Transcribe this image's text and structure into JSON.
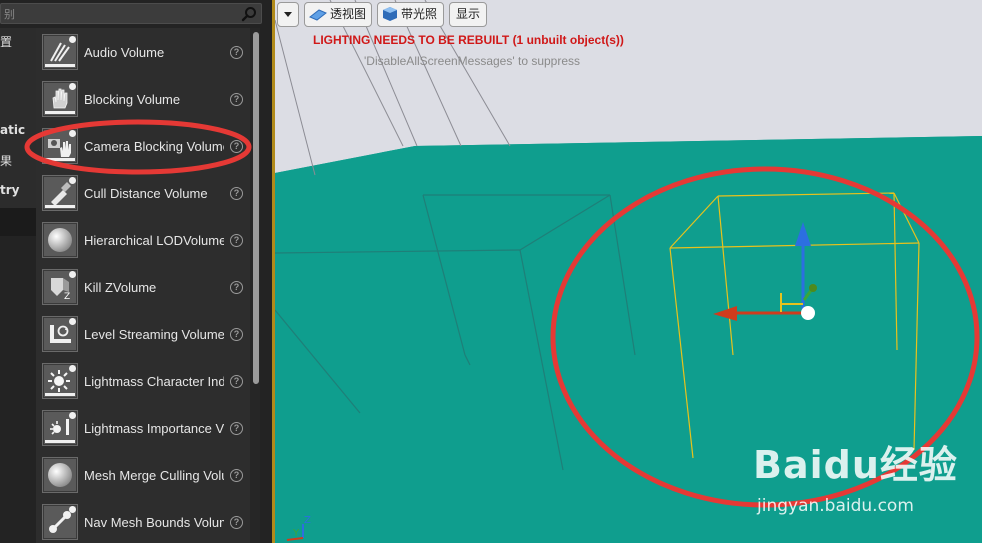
{
  "search": {
    "placeholder_fragment": "别"
  },
  "categories": [
    {
      "label": "置"
    },
    {
      "label": "atic"
    },
    {
      "label": "果"
    },
    {
      "label": "try"
    }
  ],
  "items": [
    {
      "label": "Audio Volume",
      "icon": "audio-volume-icon"
    },
    {
      "label": "Blocking Volume",
      "icon": "hand-icon"
    },
    {
      "label": "Camera Blocking Volume",
      "icon": "camera-hand-icon"
    },
    {
      "label": "Cull Distance Volume",
      "icon": "cull-distance-icon"
    },
    {
      "label": "Hierarchical LODVolume",
      "icon": "sphere-icon"
    },
    {
      "label": "Kill ZVolume",
      "icon": "kill-z-icon"
    },
    {
      "label": "Level Streaming Volume",
      "icon": "level-streaming-icon"
    },
    {
      "label": "Lightmass Character Indirect Detail Volume",
      "icon": "sun-icon"
    },
    {
      "label": "Lightmass Importance Volume",
      "icon": "lightbulb-icon"
    },
    {
      "label": "Mesh Merge Culling Volume",
      "icon": "sphere-icon"
    },
    {
      "label": "Nav Mesh Bounds Volume",
      "icon": "nav-mesh-icon"
    }
  ],
  "help_glyph": "?",
  "toolbar": {
    "dropdown_icon": "triangle-down-icon",
    "perspective_label": "透视图",
    "lit_label": "带光照",
    "show_label": "显示"
  },
  "viewport": {
    "warning": "LIGHTING NEEDS TO BE REBUILT (1 unbuilt object(s))",
    "suppress": "'DisableAllScreenMessages' to suppress",
    "gizmo_axis_z": "Z",
    "gizmo_axis_y": "Y"
  },
  "colors": {
    "floor": "#0f9e8e",
    "sky": "#dcdde4",
    "warning": "#d01818",
    "annotation_circle": "#e53935",
    "volume_outline": "#e8c21c"
  },
  "watermark": {
    "logo": "Baidu经验",
    "site": "jingyan.baidu.com"
  }
}
